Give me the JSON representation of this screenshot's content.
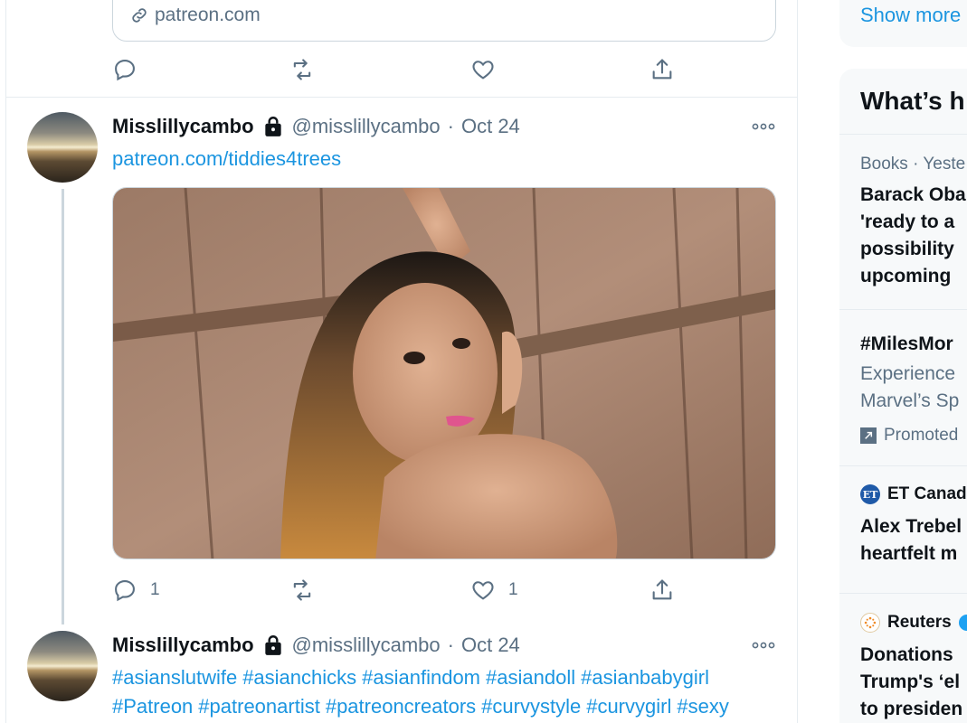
{
  "timeline": {
    "prev_tweet": {
      "link_card_domain": "patreon.com",
      "actions": {
        "reply_count": "",
        "retweet_count": "",
        "like_count": ""
      }
    },
    "tweets": [
      {
        "display_name": "Misslillycambo",
        "handle": "@misslillycambo",
        "separator": "·",
        "date": "Oct 24",
        "link_text": "patreon.com/tiddies4trees",
        "actions": {
          "reply_count": "1",
          "retweet_count": "",
          "like_count": "1"
        }
      },
      {
        "display_name": "Misslillycambo",
        "handle": "@misslillycambo",
        "separator": "·",
        "date": "Oct 24",
        "hashtags_line1": [
          "#asianslutwife",
          "#asianchicks",
          "#asianfindom",
          "#asiandoll",
          "#asianbabygirl"
        ],
        "hashtags_line2": [
          "#Patreon",
          "#patreonartist",
          "#patreoncreators",
          "#curvystyle",
          "#curvygirl",
          "#sexy"
        ]
      }
    ]
  },
  "sidebar": {
    "show_more": "Show more",
    "trends_header": "What’s h",
    "trends": [
      {
        "meta": "Books · Yeste",
        "lines": [
          "Barack Oba",
          "'ready to a",
          "possibility",
          "upcoming"
        ]
      },
      {
        "title": "#MilesMor",
        "lines": [
          "Experience",
          "Marvel’s Sp"
        ],
        "promoted": "Promoted"
      },
      {
        "source": "ET Canad",
        "source_logo": "ET",
        "lines": [
          "Alex Trebel",
          "heartfelt m"
        ]
      },
      {
        "source": "Reuters",
        "lines": [
          "Donations",
          "Trump's ‘el",
          "to presiden"
        ]
      }
    ]
  },
  "colors": {
    "link_blue": "#1b95e0",
    "muted": "#5b7083",
    "border": "#ccd6dd",
    "sidebar_bg": "#f7f9fa"
  }
}
